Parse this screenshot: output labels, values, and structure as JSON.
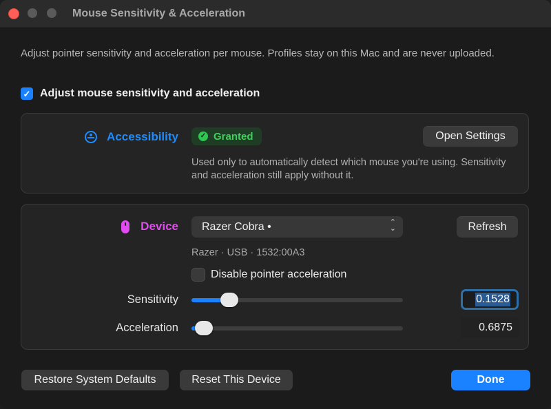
{
  "window": {
    "title": "Mouse Sensitivity & Acceleration"
  },
  "intro": "Adjust pointer sensitivity and acceleration per mouse. Profiles stay on this Mac and are never uploaded.",
  "master_toggle": {
    "label": "Adjust mouse sensitivity and acceleration",
    "checked": true
  },
  "accessibility": {
    "label": "Accessibility",
    "status": "Granted",
    "button": "Open Settings",
    "description": "Used only to automatically detect which mouse you're using. Sensitivity and acceleration still apply without it.",
    "accent_color": "#1c8cff",
    "status_color": "#3fcf5c"
  },
  "device": {
    "label": "Device",
    "selected": "Razer Cobra •",
    "refresh_button": "Refresh",
    "info": "Razer · USB · 1532:00A3",
    "accent_color": "#e14cf0",
    "disable_accel": {
      "label": "Disable pointer acceleration",
      "checked": false
    },
    "sensitivity": {
      "label": "Sensitivity",
      "value": "0.1528",
      "fraction": 0.18
    },
    "acceleration": {
      "label": "Acceleration",
      "value": "0.6875",
      "fraction": 0.06
    }
  },
  "footer": {
    "restore": "Restore System Defaults",
    "reset": "Reset This Device",
    "done": "Done"
  }
}
